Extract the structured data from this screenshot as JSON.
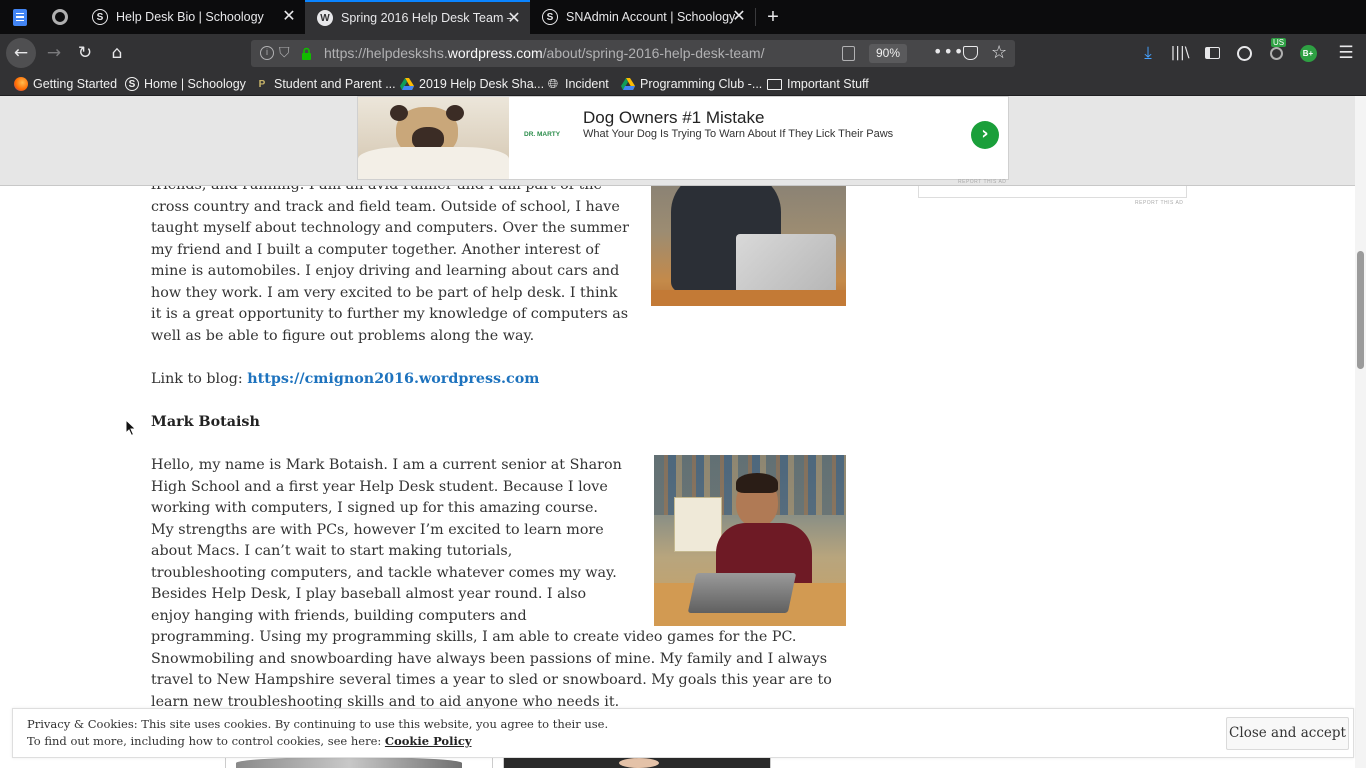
{
  "browser": {
    "tabs": [
      {
        "title": "",
        "favicon": "docs-icon"
      },
      {
        "title": "",
        "favicon": "extension-icon"
      },
      {
        "title": "Help Desk Bio | Schoology",
        "favicon": "schoology-icon"
      },
      {
        "title": "Spring 2016 Help Desk Team – ",
        "favicon": "wordpress-icon"
      },
      {
        "title": "SNAdmin Account | Schoology",
        "favicon": "schoology-icon"
      }
    ],
    "new_tab_label": "+",
    "url_prefix": "https://helpdeskshs.",
    "url_domain": "wordpress.com",
    "url_path": "/about/spring-2016-help-desk-team/",
    "zoom": "90%",
    "profile_badge": "US",
    "grade_badge": "B+",
    "bookmarks": [
      {
        "label": "Getting Started",
        "icon": "firefox-icon"
      },
      {
        "label": "Home | Schoology",
        "icon": "schoology-icon"
      },
      {
        "label": "Student and Parent ...",
        "icon": "powerschool-icon"
      },
      {
        "label": "2019 Help Desk Sha...",
        "icon": "drive-icon"
      },
      {
        "label": "Incident",
        "icon": "globe-icon"
      },
      {
        "label": "Programming Club -...",
        "icon": "drive-icon"
      },
      {
        "label": "Important Stuff",
        "icon": "folder-icon"
      }
    ]
  },
  "ad": {
    "title": "Dog Owners #1 Mistake",
    "subtitle": "What Your Dog Is Trying To Warn About If They Lick Their Paws",
    "brand": "DR. MARTY",
    "report": "REPORT THIS AD"
  },
  "article": {
    "bio1_tail": "friends, and running. I am an avid runner and I am part of the cross country and track and field team. Outside of school, I have taught myself about technology and computers. Over the summer my friend and I built a computer together. Another interest of mine is automobiles. I enjoy driving and learning about cars and how they work. I am very excited to be part of help desk. I think it is a great opportunity to further my knowledge of computers as well as be able to figure out problems along the way.",
    "blog_prefix": "Link to blog: ",
    "blog_link": "https://cmignon2016.wordpress.com",
    "name2": "Mark Botaish",
    "bio2": "Hello, my name is Mark Botaish. I am a current senior at Sharon High School and a first year Help Desk student. Because I love working with computers, I signed up for this amazing course. My strengths are with PCs, however I’m excited to learn more about Macs. I can’t wait to start making tutorials, troubleshooting computers, and tackle whatever comes my way.  Besides Help Desk, I play baseball almost year round.  I also enjoy hanging with friends, building computers and programming.  Using my programming skills, I am able to create video games for the PC.  Snowmobiling and snowboarding have always been passions of mine. My family and I always travel to New Hampshire several times a year to sled or snowboard. My goals this year are to learn new troubleshooting skills and to aid anyone who needs it."
  },
  "sidebar": {
    "report": "REPORT THIS AD"
  },
  "cookie": {
    "line1": "Privacy & Cookies: This site uses cookies. By continuing to use this website, you agree to their use.",
    "line2_prefix": "To find out more, including how to control cookies, see here: ",
    "policy_link": "Cookie Policy",
    "button": "Close and accept"
  }
}
